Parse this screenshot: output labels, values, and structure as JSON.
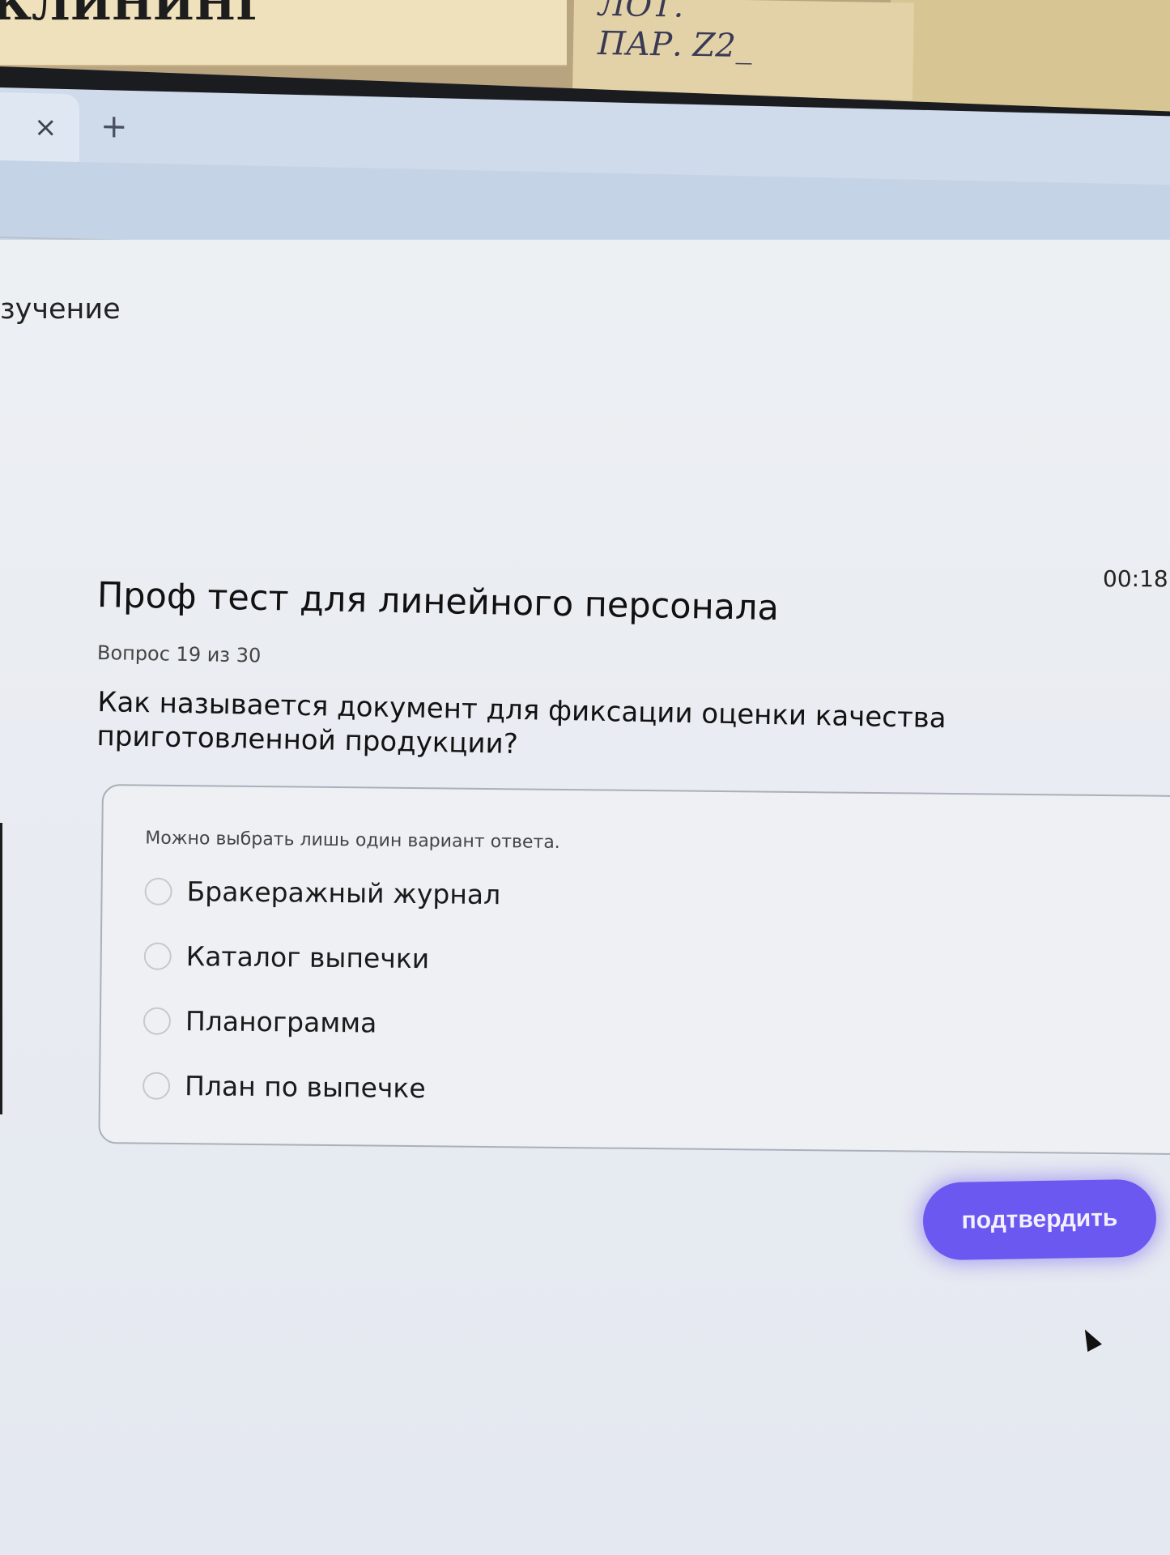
{
  "photo_labels": {
    "sticker_left_text": "КЛИНИНГ",
    "sticker_right_line1": "ЛОТ.",
    "sticker_right_line2": "ПАР. Z2_"
  },
  "browser": {
    "tab_close_glyph": "×",
    "new_tab_glyph": "+"
  },
  "nav": {
    "section_label": "зучение"
  },
  "quiz": {
    "timer": "00:18:",
    "title": "Проф тест для линейного персонала",
    "counter": "Вопрос 19 из 30",
    "question": "Как называется документ для фиксации оценки качества приготовленной продукции?",
    "hint": "Можно выбрать лишь один вариант ответа.",
    "options": [
      {
        "label": "Бракеражный журнал",
        "selected": false
      },
      {
        "label": "Каталог выпечки",
        "selected": false
      },
      {
        "label": "Планограмма",
        "selected": false
      },
      {
        "label": "План по выпечке",
        "selected": false
      }
    ],
    "confirm_label": "подтвердить",
    "accent_color": "#6b58f0"
  }
}
